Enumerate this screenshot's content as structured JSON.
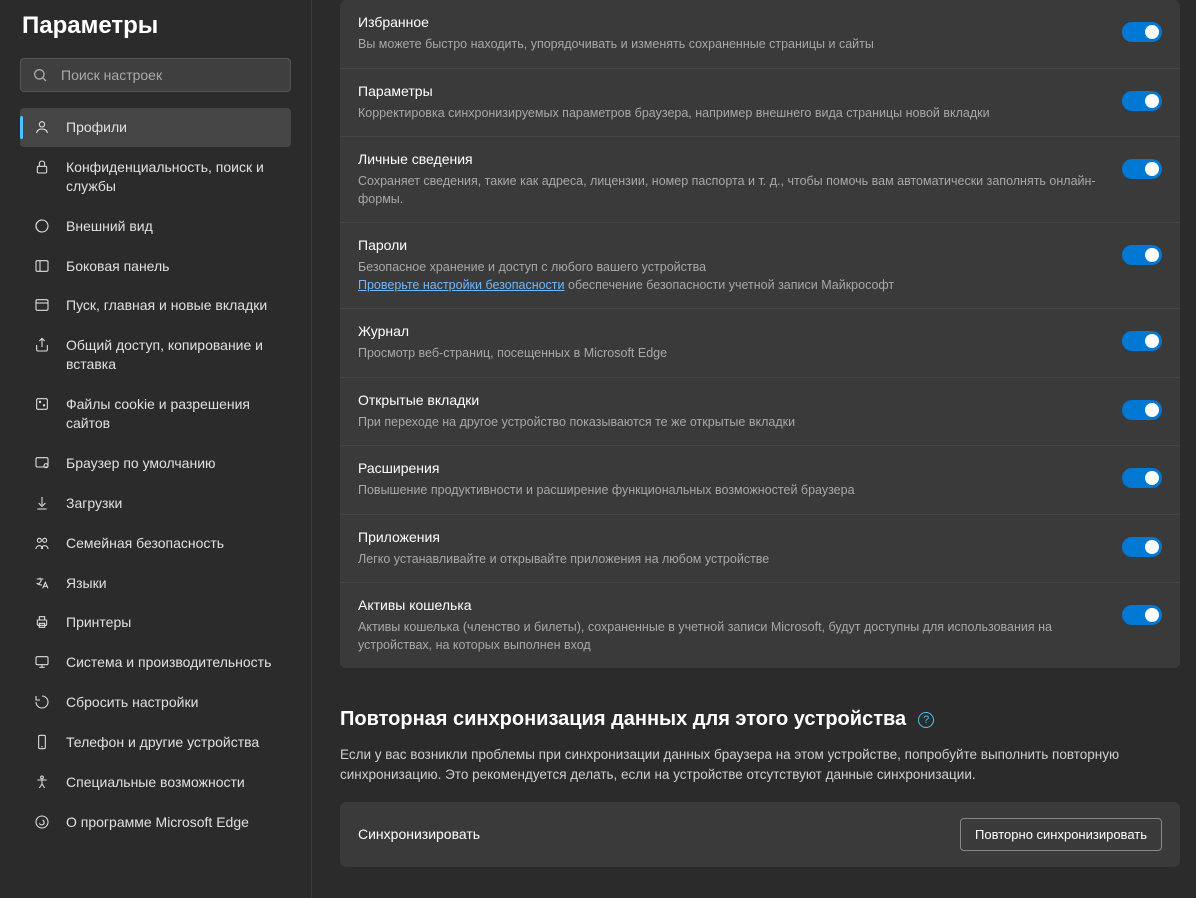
{
  "sidebar": {
    "title": "Параметры",
    "search_placeholder": "Поиск настроек",
    "items": [
      {
        "label": "Профили",
        "icon": "profile-icon",
        "active": true
      },
      {
        "label": "Конфиденциальность, поиск и службы",
        "icon": "lock-icon"
      },
      {
        "label": "Внешний вид",
        "icon": "appearance-icon"
      },
      {
        "label": "Боковая панель",
        "icon": "sidebar-icon"
      },
      {
        "label": "Пуск, главная и новые вкладки",
        "icon": "start-icon"
      },
      {
        "label": "Общий доступ, копирование и вставка",
        "icon": "share-icon"
      },
      {
        "label": "Файлы cookie и разрешения сайтов",
        "icon": "cookies-icon"
      },
      {
        "label": "Браузер по умолчанию",
        "icon": "default-browser-icon"
      },
      {
        "label": "Загрузки",
        "icon": "download-icon"
      },
      {
        "label": "Семейная безопасность",
        "icon": "family-icon"
      },
      {
        "label": "Языки",
        "icon": "language-icon"
      },
      {
        "label": "Принтеры",
        "icon": "printer-icon"
      },
      {
        "label": "Система и производительность",
        "icon": "system-icon"
      },
      {
        "label": "Сбросить настройки",
        "icon": "reset-icon"
      },
      {
        "label": "Телефон и другие устройства",
        "icon": "phone-icon"
      },
      {
        "label": "Специальные возможности",
        "icon": "accessibility-icon"
      },
      {
        "label": "О программе Microsoft Edge",
        "icon": "about-icon"
      }
    ]
  },
  "sync_options": [
    {
      "title": "Избранное",
      "desc": "Вы можете быстро находить, упорядочивать и изменять сохраненные страницы и сайты"
    },
    {
      "title": "Параметры",
      "desc": "Корректировка синхронизируемых параметров браузера, например внешнего вида страницы новой вкладки"
    },
    {
      "title": "Личные сведения",
      "desc": "Сохраняет сведения, такие как адреса, лицензии, номер паспорта и т. д., чтобы помочь вам автоматически заполнять онлайн-формы."
    },
    {
      "title": "Пароли",
      "desc_prefix": "Безопасное хранение и доступ с любого вашего устройства",
      "link": "Проверьте настройки безопасности",
      "desc_suffix": " обеспечение безопасности учетной записи Майкрософт"
    },
    {
      "title": "Журнал",
      "desc": "Просмотр веб-страниц, посещенных в Microsoft Edge"
    },
    {
      "title": "Открытые вкладки",
      "desc": "При переходе на другое устройство показываются те же открытые вкладки"
    },
    {
      "title": "Расширения",
      "desc": "Повышение продуктивности и расширение функциональных возможностей браузера"
    },
    {
      "title": "Приложения",
      "desc": "Легко устанавливайте и открывайте приложения на любом устройстве"
    },
    {
      "title": "Активы кошелька",
      "desc": "Активы кошелька (членство и билеты), сохраненные в учетной записи Microsoft, будут доступны для использования на устройствах, на которых выполнен вход"
    }
  ],
  "resync": {
    "heading": "Повторная синхронизация данных для этого устройства",
    "note": "Если у вас возникли проблемы при синхронизации данных браузера на этом устройстве, попробуйте выполнить повторную синхронизацию. Это рекомендуется делать, если на устройстве отсутствуют данные синхронизации.",
    "row_label": "Синхронизировать",
    "button": "Повторно синхронизировать"
  }
}
